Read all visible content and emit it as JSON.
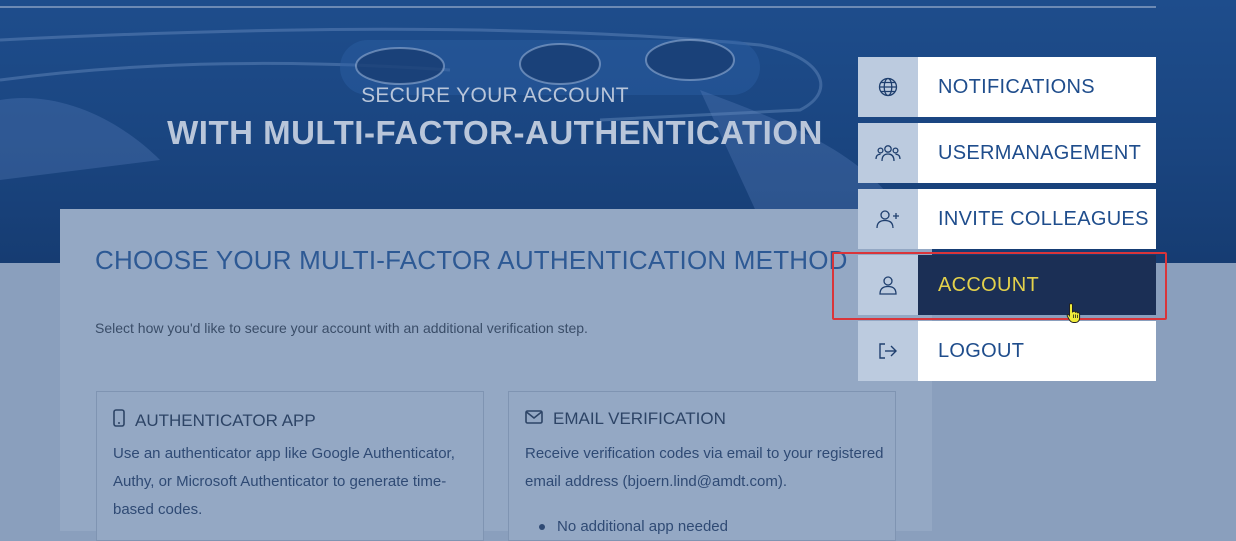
{
  "hero": {
    "subtitle": "SECURE YOUR ACCOUNT",
    "title": "WITH MULTI-FACTOR-AUTHENTICATION"
  },
  "panel": {
    "title": "CHOOSE YOUR MULTI-FACTOR AUTHENTICATION METHOD",
    "description": "Select how you'd like to secure your account with an additional verification step."
  },
  "methods": [
    {
      "icon": "smartphone-icon",
      "title": "AUTHENTICATOR APP",
      "text": "Use an authenticator app like Google Authenticator, Authy, or Microsoft Authenticator to generate time-based codes."
    },
    {
      "icon": "envelope-icon",
      "title": "EMAIL VERIFICATION",
      "text": "Receive verification codes via email to your registered email address (bjoern.lind@amdt.com).",
      "bullet": "No additional app needed"
    }
  ],
  "menu": {
    "items": [
      {
        "label": "NOTIFICATIONS",
        "icon": "globe-icon"
      },
      {
        "label": "USERMANAGEMENT",
        "icon": "users-icon"
      },
      {
        "label": "INVITE COLLEAGUES",
        "icon": "user-plus-icon"
      },
      {
        "label": "ACCOUNT",
        "icon": "user-icon",
        "active": true
      },
      {
        "label": "LOGOUT",
        "icon": "logout-icon"
      }
    ]
  },
  "colors": {
    "menu_active_bg": "#1b2f55",
    "menu_active_text": "#e3d14b",
    "menu_text": "#1f4d8c",
    "highlight": "#d9353a"
  }
}
